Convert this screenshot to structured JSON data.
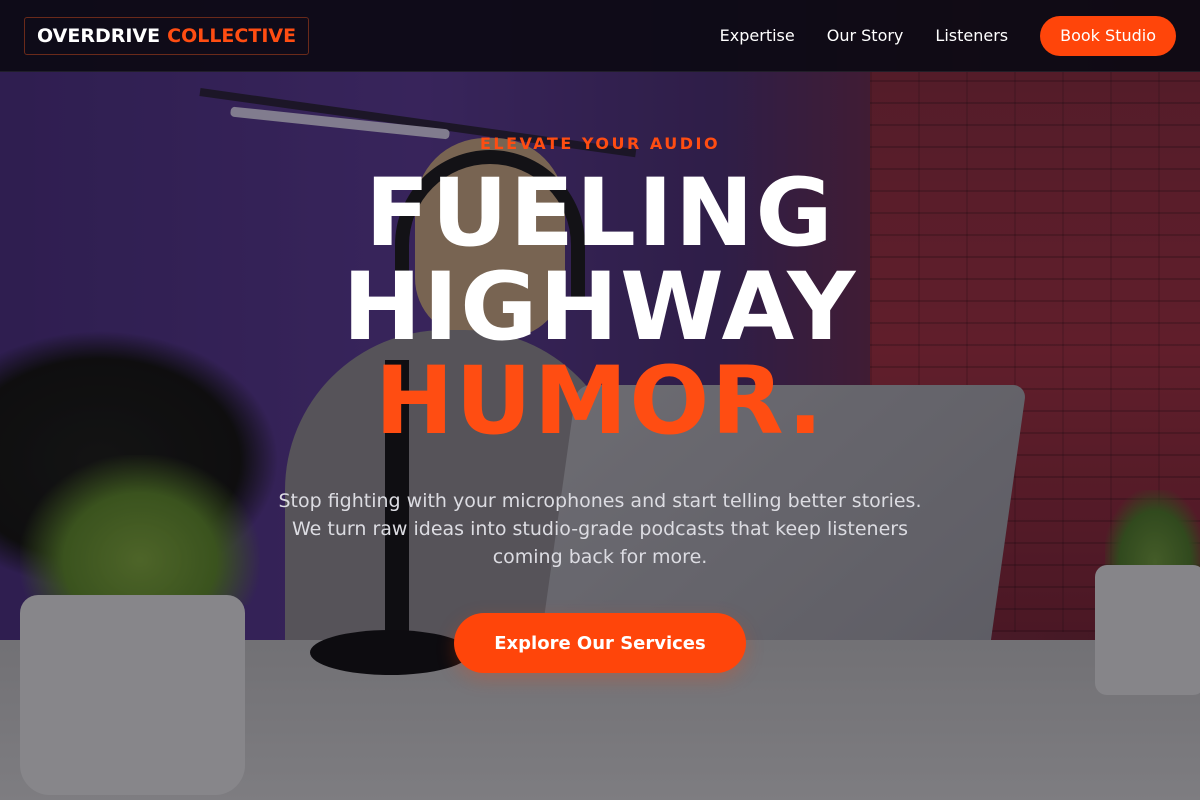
{
  "brand": {
    "name_primary": "OVERDRIVE",
    "name_accent": "COLLECTIVE"
  },
  "nav": {
    "items": [
      {
        "label": "Expertise"
      },
      {
        "label": "Our Story"
      },
      {
        "label": "Listeners"
      }
    ],
    "cta_label": "Book Studio"
  },
  "hero": {
    "eyebrow": "ELEVATE YOUR AUDIO",
    "headline_line1": "FUELING",
    "headline_line2": "HIGHWAY",
    "headline_accent": "HUMOR.",
    "subtext": "Stop fighting with your microphones and start telling better stories. We turn raw ideas into studio-grade podcasts that keep listeners coming back for more.",
    "cta_label": "Explore Our Services"
  },
  "colors": {
    "accent": "#ff4d12",
    "header_bg": "#0c0a14"
  }
}
